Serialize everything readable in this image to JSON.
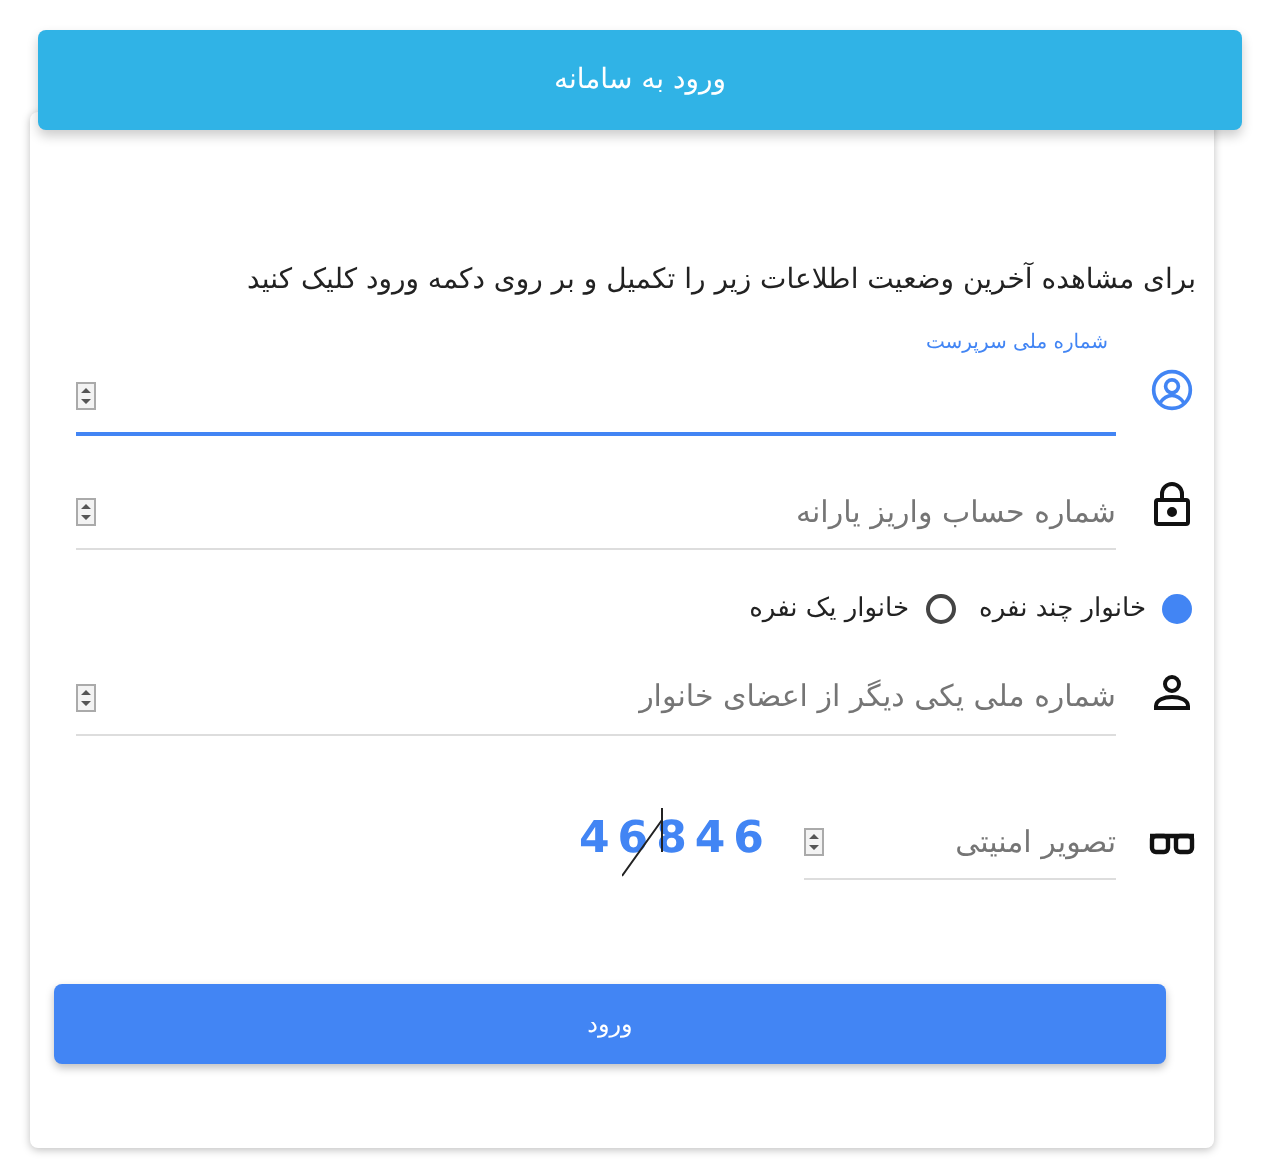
{
  "header": {
    "title": "ورود به سامانه"
  },
  "instruction": "برای مشاهده آخرین وضعیت اطلاعات زیر را تکمیل و بر روی دکمه ورود کلیک کنید",
  "fields": [
    {
      "label": "شماره ملی سرپرست",
      "focused": true
    },
    {
      "label": "شماره حساب واریز یارانه",
      "focused": false
    }
  ],
  "household_type": [
    {
      "label": "خانوار چند نفره",
      "selected": true
    },
    {
      "label": "خانوار یک نفره",
      "selected": false
    }
  ],
  "member_field": {
    "label": "شماره ملی یکی دیگر از اعضای خانوار",
    "focused": false
  },
  "captcha": {
    "label": "تصویر امنیتی",
    "code": "46846"
  },
  "submit": "ورود"
}
